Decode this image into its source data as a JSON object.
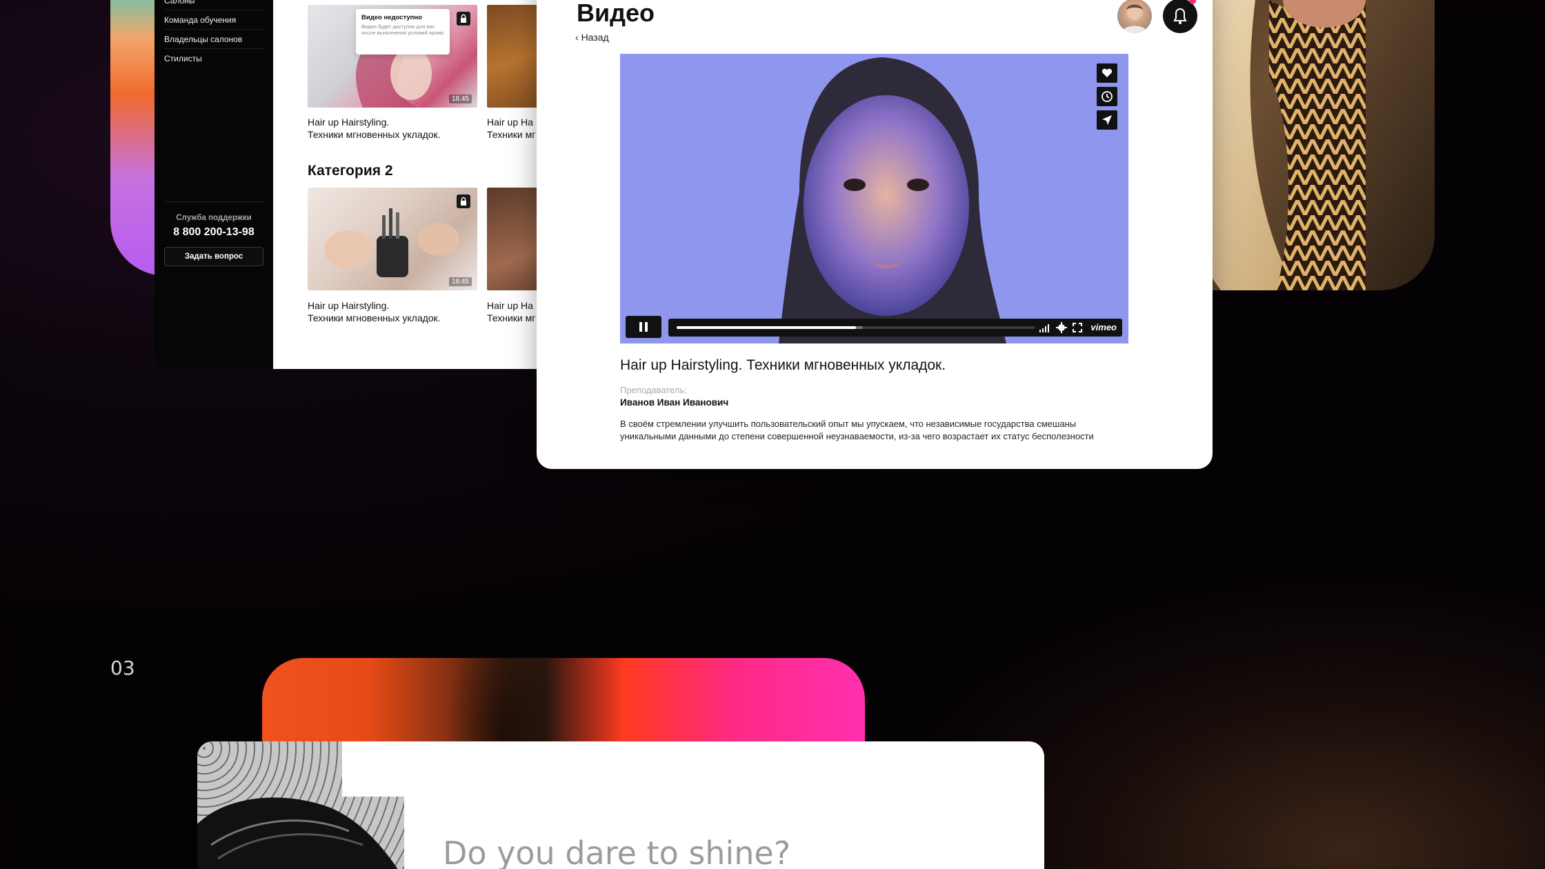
{
  "sidebar": {
    "items": [
      {
        "label": "Салоны"
      },
      {
        "label": "Команда обучения"
      },
      {
        "label": "Владельцы салонов"
      },
      {
        "label": "Стилисты"
      }
    ],
    "support_title": "Служба поддержки",
    "support_phone": "8 800 200-13-98",
    "ask_button": "Задать вопрос"
  },
  "catalog": {
    "tooltip_title": "Видео недоступно",
    "tooltip_text": "Видео будет доступно для вас после выполнения условий промо",
    "category2_title": "Категория 2",
    "videos": [
      {
        "duration": "18:45",
        "caption_line1": "Hair up Hairstyling.",
        "caption_line2": "Техники мгновенных укладок."
      },
      {
        "caption_line1": "Hair up Ha",
        "caption_line2": "Техники мг"
      },
      {
        "duration": "18:45",
        "caption_line1": "Hair up Hairstyling.",
        "caption_line2": "Техники мгновенных укладок."
      },
      {
        "caption_line1": "Hair up Ha",
        "caption_line2": "Техники мг"
      }
    ]
  },
  "video_page": {
    "title": "Видео",
    "back_label": "Назад",
    "player": {
      "progress": 0.5,
      "buffered": 0.52,
      "brand": "vimeo"
    },
    "video_title": "Hair up Hairstyling. Техники мгновенных укладок.",
    "teacher_label": "Преподаватель:",
    "teacher_name": "Иванов Иван Иванович",
    "description": "В своём стремлении улучшить пользовательский опыт мы упускаем, что независимые государства смешаны уникальными данными до степени совершенной неузнаваемости, из-за чего возрастает их статус бесполезности"
  },
  "section_number": "03",
  "bottom_heading": "Do you dare to shine?",
  "colors": {
    "accent_pink": "#ff2a6a",
    "player_bg": "#8c93ea",
    "banner_orange": "#f0521f",
    "banner_pink": "#ff2fb0"
  }
}
